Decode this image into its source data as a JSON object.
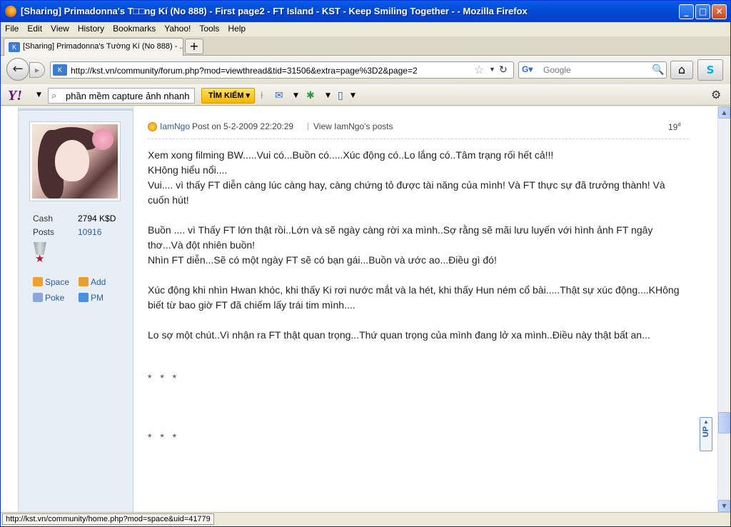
{
  "window": {
    "title": "[Sharing] Primadonna's T□□ng Kí (No 888) - First page2 - FT Island - KST - Keep Smiling Together - - Mozilla Firefox"
  },
  "menu": [
    "File",
    "Edit",
    "View",
    "History",
    "Bookmarks",
    "Yahoo!",
    "Tools",
    "Help"
  ],
  "tab": {
    "label": "[Sharing] Primadonna's Tường Kí (No 888) - ..."
  },
  "nav": {
    "url": "http://kst.vn/community/forum.php?mod=viewthread&tid=31506&extra=page%3D2&page=2",
    "search_placeholder": "Google"
  },
  "yahoo": {
    "logo": "Y!",
    "query": "phần mềm capture ảnh nhanh",
    "search_button": "TÌM KIẾM"
  },
  "user": {
    "stats": [
      {
        "label": "Cash",
        "value": "2794 K$D"
      },
      {
        "label": "Posts",
        "value": "10916"
      }
    ],
    "actions": {
      "space": "Space",
      "add": "Add",
      "poke": "Poke",
      "pm": "PM"
    }
  },
  "post": {
    "author": "IamNgo",
    "posted_on": "Post on 5-2-2009 22:20:29",
    "view_posts": "View IamNgo's posts",
    "floor": "19",
    "floor_mark": "#",
    "body": [
      "Xem xong filming BW.....Vui có...Buồn có.....Xúc động có..Lo lắng có..Tâm trạng rối hết cả!!!",
      "KHông hiểu nổi....",
      "Vui.... vì thấy FT diễn càng lúc càng hay, càng chứng tỏ được tài năng của mình! Và FT thực sự đã trưởng thành! Và cuốn hút!",
      "",
      "Buồn .... vì Thấy FT lớn thật rồi..Lớn và sẽ ngày càng rời xa mình..Sợ rằng sẽ mãi lưu luyến với hình ảnh FT ngây thơ...Và đột nhiên buồn!",
      "Nhìn FT diễn...Sẽ có một ngày FT sẽ có bạn gái...Buồn và ước ao...Điều gì đó!",
      "",
      "Xúc động khi nhìn Hwan khóc, khi thấy Ki rơi nước mắt và la hét, khi thấy Hun ném cổ bài.....Thật sự xúc động....KHông biết từ bao giờ FT đã chiếm lấy trái tim mình....",
      "",
      "Lo sợ một chút..Vì nhận ra FT thật quan trọng...Thứ quan trọng của mình đang lở xa mình..Điều này thật bất an..."
    ],
    "separator_1": "* * *",
    "separator_2": "* * *"
  },
  "up_widget": "UP",
  "status": {
    "url": "http://kst.vn/community/home.php?mod=space&uid=41779"
  },
  "colors": {
    "titlebar": "#0454de",
    "sidebar": "#e8eef6",
    "link": "#2c5c9a",
    "yahoo_button": "#f4b400"
  }
}
